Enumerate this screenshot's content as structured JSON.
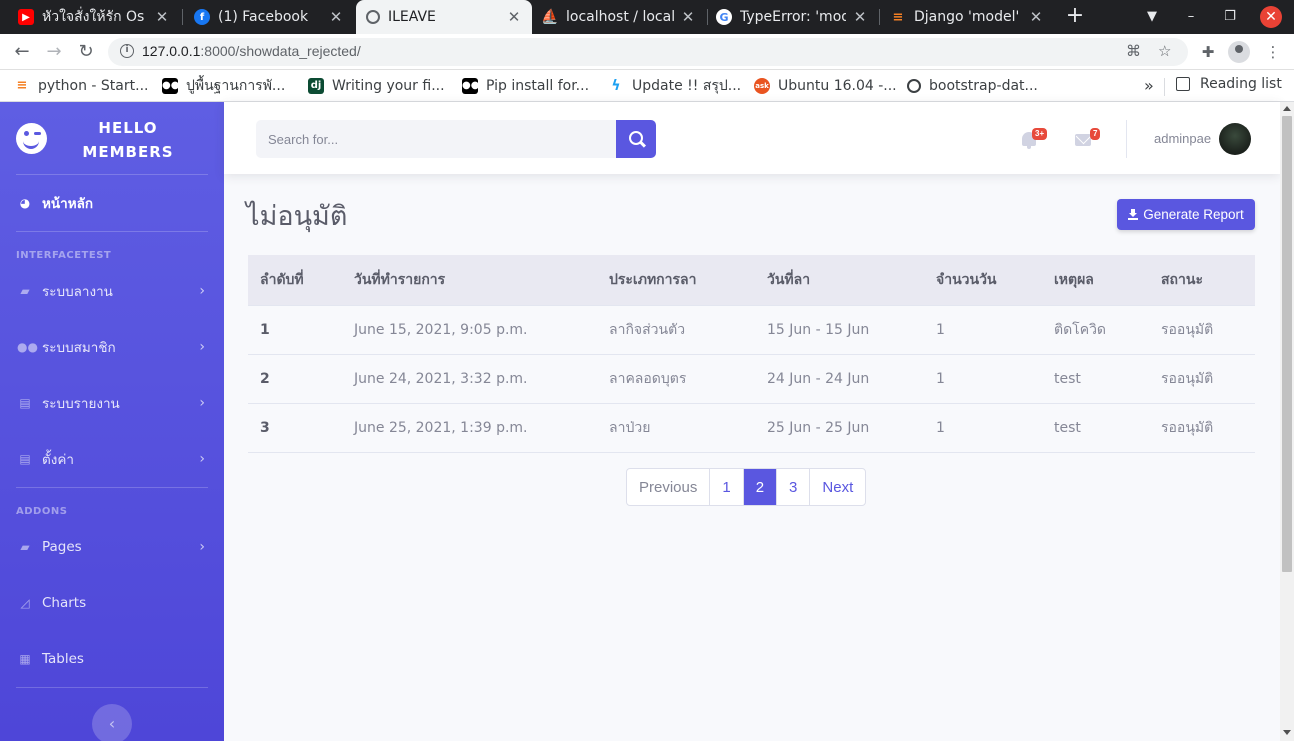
{
  "browser": {
    "tabs": [
      {
        "label": "หัวใจสั่งให้รัก Os",
        "icon": "youtube-icon",
        "color": "#ff0000"
      },
      {
        "label": "(1) Facebook",
        "icon": "facebook-icon",
        "color": "#1877f2"
      },
      {
        "label": "ILEAVE",
        "icon": "globe-icon",
        "color": "#5f6368"
      },
      {
        "label": "localhost / local",
        "icon": "phpmyadmin-icon",
        "color": "#f29111"
      },
      {
        "label": "TypeError: 'mod",
        "icon": "google-icon",
        "color": "#4285f4"
      },
      {
        "label": "Django 'model'",
        "icon": "stackoverflow-icon",
        "color": "#f48024"
      }
    ],
    "url_host": "127.0.0.1",
    "url_rest": ":8000/showdata_rejected/",
    "bookmarks": [
      {
        "label": "python - Start...",
        "icon": "stackoverflow-icon",
        "color": "#f48024"
      },
      {
        "label": "ปูพื้นฐานการพั...",
        "icon": "medium-icon",
        "color": "#000000"
      },
      {
        "label": "Writing your fi...",
        "icon": "django-icon",
        "color": "#0c4b33"
      },
      {
        "label": "Pip install for...",
        "icon": "medium-icon",
        "color": "#000000"
      },
      {
        "label": "Update !! สรุป...",
        "icon": "bolt-icon",
        "color": "#1da1f2"
      },
      {
        "label": "Ubuntu 16.04 -...",
        "icon": "askubuntu-icon",
        "color": "#e95420"
      },
      {
        "label": "bootstrap-dat...",
        "icon": "globe-icon",
        "color": "#3c4043"
      }
    ],
    "more": "»",
    "reading_list": "Reading list"
  },
  "sidebar": {
    "brand_line1": "HELLO",
    "brand_line2": "MEMBERS",
    "dashboard": "หน้าหลัก",
    "heading_interface": "INTERFACETEST",
    "heading_addons": "ADDONS",
    "items": [
      {
        "label": "ระบบลางาน",
        "icon": "folder-icon"
      },
      {
        "label": "ระบบสมาชิก",
        "icon": "users-icon"
      },
      {
        "label": "ระบบรายงาน",
        "icon": "file-icon"
      },
      {
        "label": "ตั้งค่า",
        "icon": "file-icon"
      }
    ],
    "addons": [
      {
        "label": "Pages",
        "icon": "folder-icon"
      },
      {
        "label": "Charts",
        "icon": "chart-area-icon"
      },
      {
        "label": "Tables",
        "icon": "table-icon"
      }
    ]
  },
  "topbar": {
    "search_placeholder": "Search for...",
    "alerts_badge": "3+",
    "messages_badge": "7",
    "username": "adminpae"
  },
  "main": {
    "title": "ไม่อนุมัติ",
    "report_button": "Generate Report",
    "table": {
      "headers": [
        "ลำดับที่",
        "วันที่ทำรายการ",
        "ประเภทการลา",
        "วันที่ลา",
        "จำนวนวัน",
        "เหตุผล",
        "สถานะ"
      ],
      "rows": [
        [
          "1",
          "June 15, 2021, 9:05 p.m.",
          "ลากิจส่วนตัว",
          "15 Jun - 15 Jun",
          "1",
          "ติดโควิด",
          "รออนุมัติ"
        ],
        [
          "2",
          "June 24, 2021, 3:32 p.m.",
          "ลาคลอดบุตร",
          "24 Jun - 24 Jun",
          "1",
          "test",
          "รออนุมัติ"
        ],
        [
          "3",
          "June 25, 2021, 1:39 p.m.",
          "ลาป่วย",
          "25 Jun - 25 Jun",
          "1",
          "test",
          "รออนุมัติ"
        ]
      ]
    },
    "pagination": {
      "previous": "Previous",
      "pages": [
        "1",
        "2",
        "3"
      ],
      "current": "2",
      "next": "Next"
    }
  },
  "colors": {
    "primary": "#5a57e0",
    "sidebar_top": "#5f5ee3",
    "sidebar_bottom": "#4e46d8",
    "danger": "#e74a3b"
  }
}
